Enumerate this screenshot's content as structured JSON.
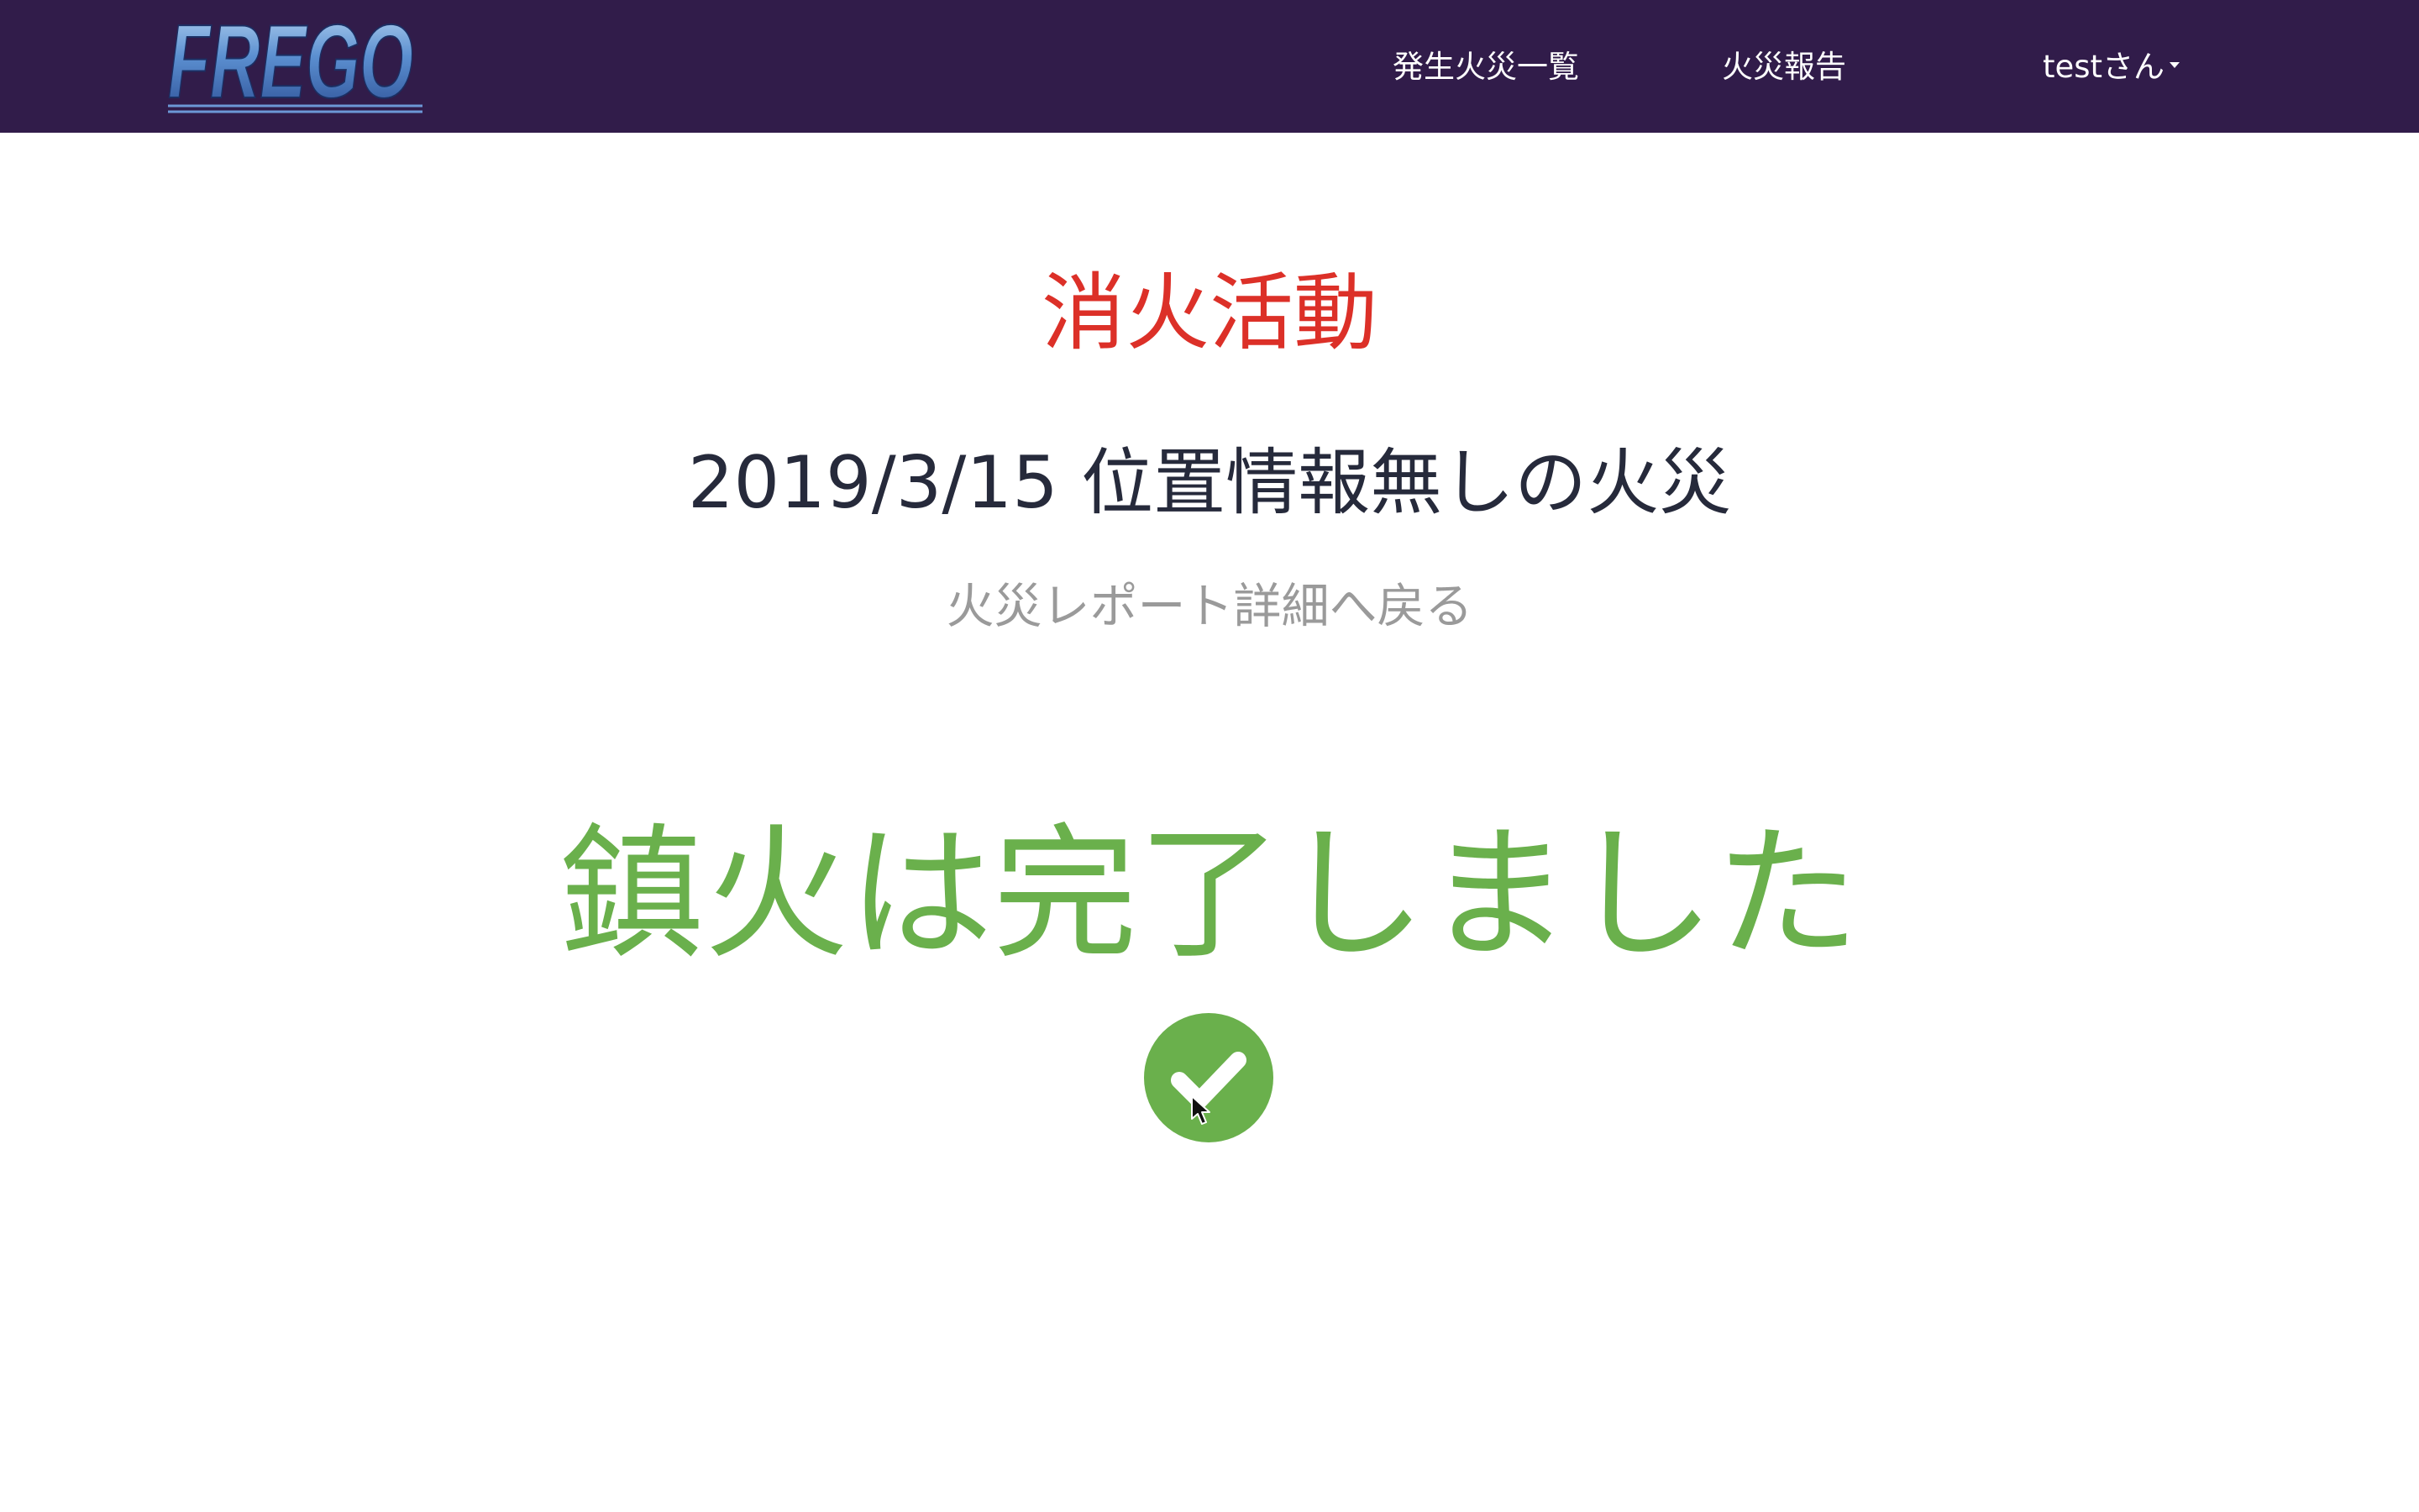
{
  "header": {
    "logo_text": "FREGO",
    "nav_fire_list": "発生火災一覧",
    "nav_fire_report": "火災報告",
    "nav_user": "testさん"
  },
  "main": {
    "section_title": "消火活動",
    "fire_name": "2019/3/15 位置情報無しの火災",
    "back_link": "火災レポート詳細へ戻る",
    "completion_message": "鎮火は完了しました",
    "status_icon": "check-circle-icon"
  },
  "colors": {
    "navbar": "#311c4a",
    "title_red": "#dc3028",
    "success_green": "#6ab04c",
    "link_gray": "#9a9a9a",
    "text_dark": "#262a3b"
  }
}
